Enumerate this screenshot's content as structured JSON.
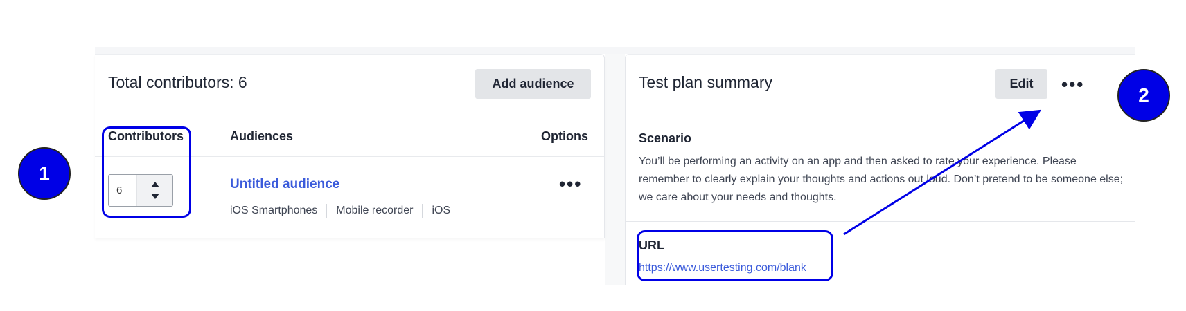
{
  "left_panel": {
    "title": "Total contributors: 6",
    "add_audience_label": "Add audience",
    "columns": {
      "contributors": "Contributors",
      "audiences": "Audiences",
      "options": "Options"
    },
    "row": {
      "contributors_value": "6",
      "audience_name": "Untitled audience",
      "tags": [
        "iOS Smartphones",
        "Mobile recorder",
        "iOS"
      ],
      "options_icon": "ellipsis-icon"
    }
  },
  "right_panel": {
    "title": "Test plan summary",
    "edit_label": "Edit",
    "more_icon": "ellipsis-icon",
    "scenario_heading": "Scenario",
    "scenario_text": "You’ll be performing an activity on an app and then asked to rate your experience. Please remember to clearly explain your thoughts and actions out loud. Don’t pretend to be someone else; we care about your needs and thoughts.",
    "url_heading": "URL",
    "url_value": "https://www.usertesting.com/blank"
  },
  "annotations": {
    "badge_1": "1",
    "badge_2": "2",
    "color": "#0000e6"
  },
  "colors": {
    "link": "#3b5bdb",
    "button_bg": "#e3e5e8",
    "text": "#1f2533"
  }
}
